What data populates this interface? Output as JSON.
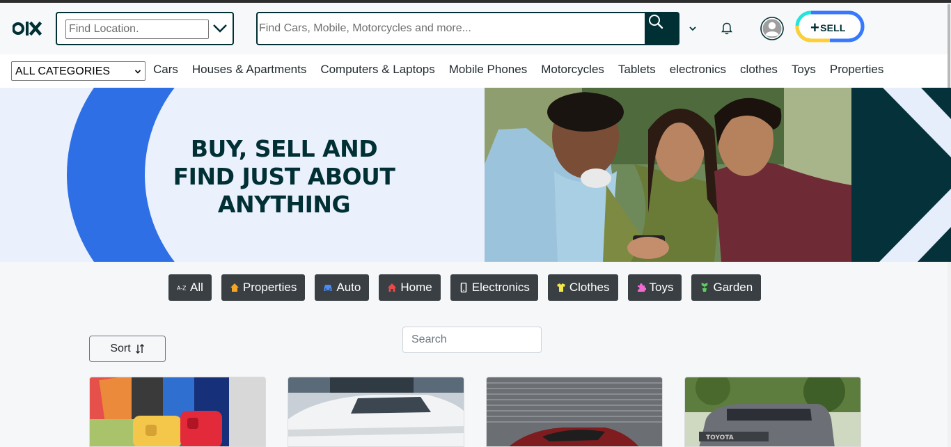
{
  "header": {
    "logo_text": "OLX",
    "location_placeholder": "Find Location.",
    "search_placeholder": "Find Cars, Mobile, Motorcycles and more...",
    "sell_label": "SELL",
    "sell_plus": "+"
  },
  "categories_bar": {
    "select_value": "ALL CATEGORIES",
    "links": [
      "Cars",
      "Houses & Apartments",
      "Computers & Laptops",
      "Mobile Phones",
      "Motorcycles",
      "Tablets",
      "electronics",
      "clothes",
      "Toys",
      "Properties"
    ]
  },
  "banner": {
    "line1": "BUY, SELL AND",
    "line2": "FIND JUST ABOUT",
    "line3": "ANYTHING"
  },
  "filter_chips": [
    {
      "label": "All",
      "icon": "az-sort-icon",
      "color": "#ffffff"
    },
    {
      "label": "Properties",
      "icon": "house-icon",
      "color": "#f5a623"
    },
    {
      "label": "Auto",
      "icon": "car-icon",
      "color": "#4a8cf7"
    },
    {
      "label": "Home",
      "icon": "home-icon",
      "color": "#e64a4a"
    },
    {
      "label": "Electronics",
      "icon": "mobile-icon",
      "color": "#ffffff"
    },
    {
      "label": "Clothes",
      "icon": "shirt-icon",
      "color": "#f2e84b"
    },
    {
      "label": "Toys",
      "icon": "puzzle-icon",
      "color": "#f06ad2"
    },
    {
      "label": "Garden",
      "icon": "plant-icon",
      "color": "#5ad15a"
    }
  ],
  "controls": {
    "sort_label": "Sort",
    "search_placeholder": "Search"
  },
  "colors": {
    "brand_dark": "#002f34",
    "chip_bg": "#3a3f44",
    "banner_blue": "#2e6fe6",
    "banner_bg": "#eaf1fd"
  }
}
